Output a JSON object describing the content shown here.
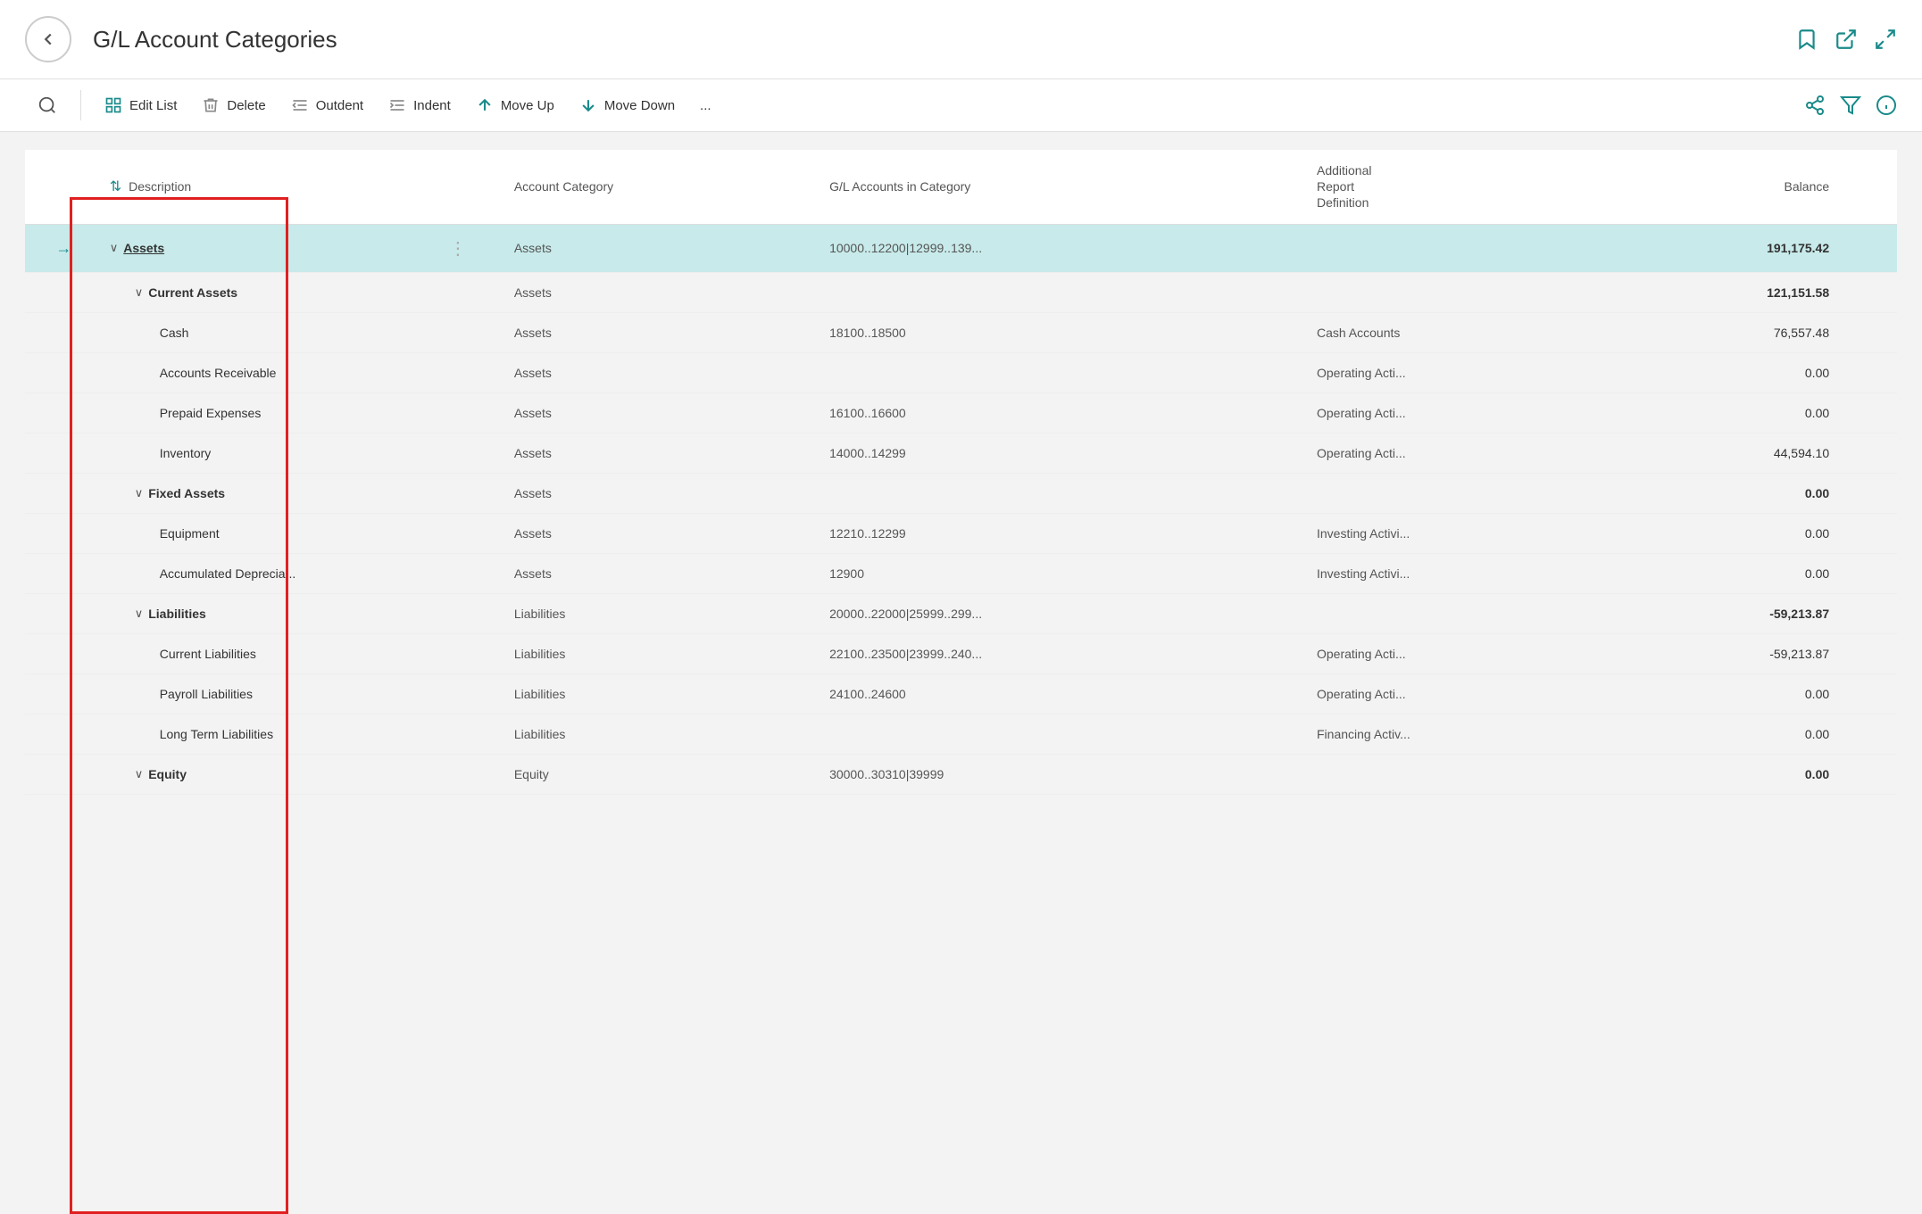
{
  "titleBar": {
    "title": "G/L Account Categories",
    "backLabel": "back",
    "icons": [
      "bookmark-icon",
      "export-icon",
      "expand-icon"
    ]
  },
  "toolbar": {
    "searchPlaceholder": "Search",
    "buttons": [
      {
        "id": "edit-list",
        "label": "Edit List",
        "icon": "grid-icon"
      },
      {
        "id": "delete",
        "label": "Delete",
        "icon": "trash-icon"
      },
      {
        "id": "outdent",
        "label": "Outdent",
        "icon": "outdent-icon"
      },
      {
        "id": "indent",
        "label": "Indent",
        "icon": "indent-icon"
      },
      {
        "id": "move-up",
        "label": "Move Up",
        "icon": "arrow-up-icon"
      },
      {
        "id": "move-down",
        "label": "Move Down",
        "icon": "arrow-down-icon"
      },
      {
        "id": "more",
        "label": "...",
        "icon": null
      }
    ],
    "rightIcons": [
      "share-icon",
      "filter-icon",
      "info-icon"
    ]
  },
  "table": {
    "columns": [
      {
        "id": "arrow",
        "label": ""
      },
      {
        "id": "chevron",
        "label": ""
      },
      {
        "id": "description",
        "label": "Description"
      },
      {
        "id": "drag",
        "label": ""
      },
      {
        "id": "account-category",
        "label": "Account Category"
      },
      {
        "id": "gl-accounts",
        "label": "G/L Accounts in Category"
      },
      {
        "id": "additional-report",
        "label": "Additional\nReport\nDefinition"
      },
      {
        "id": "balance",
        "label": "Balance"
      },
      {
        "id": "scroll",
        "label": ""
      }
    ],
    "rows": [
      {
        "id": "assets",
        "arrow": "→",
        "chevron": "∨",
        "description": "Assets",
        "descriptionUnderline": true,
        "descriptionBold": true,
        "indent": 0,
        "drag": "⋮",
        "accountCategory": "Assets",
        "glAccounts": "10000..12200|12999..139...",
        "additionalReport": "",
        "balance": "191,175.42",
        "balanceBold": true,
        "selected": true
      },
      {
        "id": "current-assets",
        "arrow": "",
        "chevron": "∨",
        "description": "Current Assets",
        "descriptionBold": true,
        "indent": 1,
        "drag": "",
        "accountCategory": "Assets",
        "glAccounts": "",
        "additionalReport": "",
        "balance": "121,151.58",
        "balanceBold": true,
        "selected": false
      },
      {
        "id": "cash",
        "arrow": "",
        "chevron": "",
        "description": "Cash",
        "descriptionBold": false,
        "indent": 2,
        "drag": "",
        "accountCategory": "Assets",
        "glAccounts": "18100..18500",
        "additionalReport": "Cash Accounts",
        "balance": "76,557.48",
        "balanceBold": false,
        "selected": false
      },
      {
        "id": "accounts-receivable",
        "arrow": "",
        "chevron": "",
        "description": "Accounts Receivable",
        "descriptionBold": false,
        "indent": 2,
        "drag": "",
        "accountCategory": "Assets",
        "glAccounts": "",
        "additionalReport": "Operating Acti...",
        "balance": "0.00",
        "balanceBold": false,
        "selected": false
      },
      {
        "id": "prepaid-expenses",
        "arrow": "",
        "chevron": "",
        "description": "Prepaid Expenses",
        "descriptionBold": false,
        "indent": 2,
        "drag": "",
        "accountCategory": "Assets",
        "glAccounts": "16100..16600",
        "additionalReport": "Operating Acti...",
        "balance": "0.00",
        "balanceBold": false,
        "selected": false
      },
      {
        "id": "inventory",
        "arrow": "",
        "chevron": "",
        "description": "Inventory",
        "descriptionBold": false,
        "indent": 2,
        "drag": "",
        "accountCategory": "Assets",
        "glAccounts": "14000..14299",
        "additionalReport": "Operating Acti...",
        "balance": "44,594.10",
        "balanceBold": false,
        "selected": false
      },
      {
        "id": "fixed-assets",
        "arrow": "",
        "chevron": "∨",
        "description": "Fixed Assets",
        "descriptionBold": true,
        "indent": 1,
        "drag": "",
        "accountCategory": "Assets",
        "glAccounts": "",
        "additionalReport": "",
        "balance": "0.00",
        "balanceBold": true,
        "selected": false
      },
      {
        "id": "equipment",
        "arrow": "",
        "chevron": "",
        "description": "Equipment",
        "descriptionBold": false,
        "indent": 2,
        "drag": "",
        "accountCategory": "Assets",
        "glAccounts": "12210..12299",
        "additionalReport": "Investing Activi...",
        "balance": "0.00",
        "balanceBold": false,
        "selected": false
      },
      {
        "id": "accumulated-deprecia",
        "arrow": "",
        "chevron": "",
        "description": "Accumulated Deprecia...",
        "descriptionBold": false,
        "indent": 2,
        "drag": "",
        "accountCategory": "Assets",
        "glAccounts": "12900",
        "additionalReport": "Investing Activi...",
        "balance": "0.00",
        "balanceBold": false,
        "selected": false
      },
      {
        "id": "liabilities",
        "arrow": "",
        "chevron": "∨",
        "description": "Liabilities",
        "descriptionBold": true,
        "indent": 1,
        "drag": "",
        "accountCategory": "Liabilities",
        "glAccounts": "20000..22000|25999..299...",
        "additionalReport": "",
        "balance": "-59,213.87",
        "balanceBold": true,
        "selected": false
      },
      {
        "id": "current-liabilities",
        "arrow": "",
        "chevron": "",
        "description": "Current Liabilities",
        "descriptionBold": false,
        "indent": 2,
        "drag": "",
        "accountCategory": "Liabilities",
        "glAccounts": "22100..23500|23999..240...",
        "additionalReport": "Operating Acti...",
        "balance": "-59,213.87",
        "balanceBold": false,
        "selected": false
      },
      {
        "id": "payroll-liabilities",
        "arrow": "",
        "chevron": "",
        "description": "Payroll Liabilities",
        "descriptionBold": false,
        "indent": 2,
        "drag": "",
        "accountCategory": "Liabilities",
        "glAccounts": "24100..24600",
        "additionalReport": "Operating Acti...",
        "balance": "0.00",
        "balanceBold": false,
        "selected": false
      },
      {
        "id": "long-term-liabilities",
        "arrow": "",
        "chevron": "",
        "description": "Long Term Liabilities",
        "descriptionBold": false,
        "indent": 2,
        "drag": "",
        "accountCategory": "Liabilities",
        "glAccounts": "",
        "additionalReport": "Financing Activ...",
        "balance": "0.00",
        "balanceBold": false,
        "selected": false
      },
      {
        "id": "equity",
        "arrow": "",
        "chevron": "∨",
        "description": "Equity",
        "descriptionBold": true,
        "indent": 1,
        "drag": "",
        "accountCategory": "Equity",
        "glAccounts": "30000..30310|39999",
        "additionalReport": "",
        "balance": "0.00",
        "balanceBold": true,
        "selected": false
      }
    ]
  }
}
